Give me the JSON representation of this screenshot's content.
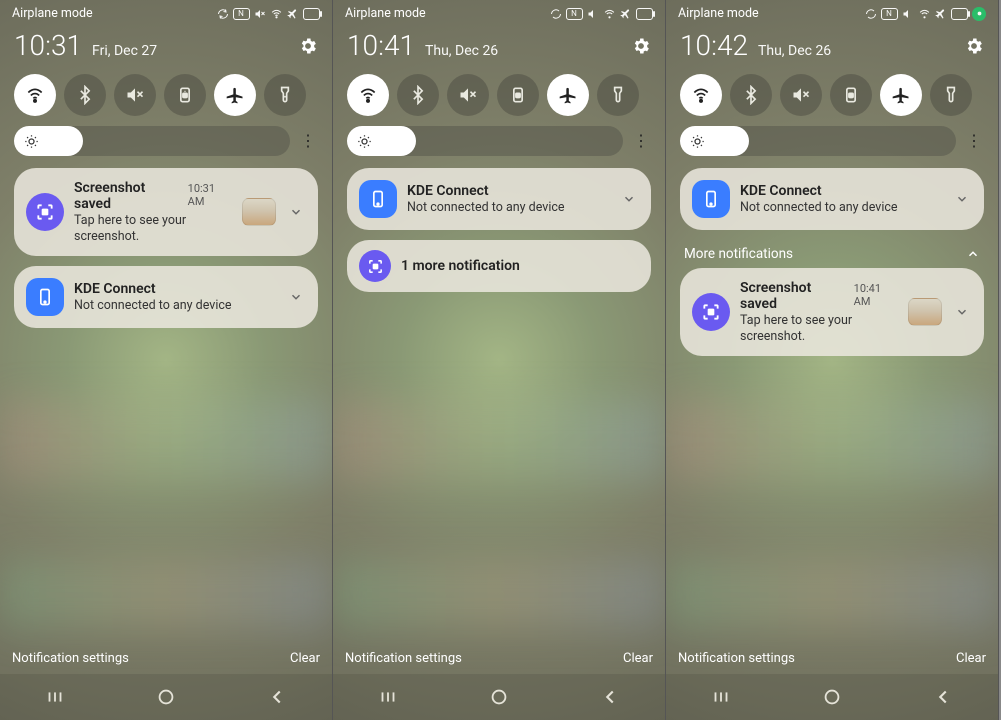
{
  "panels": [
    {
      "status_left": "Airplane mode",
      "clock": "10:31",
      "date": "Fri, Dec 27",
      "toggles": [
        "wifi",
        "bluetooth",
        "mute",
        "rotation-lock",
        "airplane",
        "flashlight"
      ],
      "active_toggles": [
        "wifi",
        "airplane"
      ],
      "notifs": [
        {
          "kind": "screenshot",
          "title": "Screenshot saved",
          "time": "10:31 AM",
          "body": "Tap here to see your screenshot.",
          "thumb": true
        },
        {
          "kind": "kde",
          "title": "KDE Connect",
          "body": "Not connected to any device"
        }
      ],
      "section_header": null,
      "more_notif_pill": null,
      "bottom_left": "Notification settings",
      "bottom_right": "Clear"
    },
    {
      "status_left": "Airplane mode",
      "clock": "10:41",
      "date": "Thu, Dec 26",
      "toggles": [
        "wifi",
        "bluetooth",
        "mute",
        "rotation-lock",
        "airplane",
        "flashlight"
      ],
      "active_toggles": [
        "wifi",
        "airplane"
      ],
      "notifs": [
        {
          "kind": "kde",
          "title": "KDE Connect",
          "body": "Not connected to any device"
        }
      ],
      "section_header": null,
      "more_notif_pill": "1 more notification",
      "bottom_left": "Notification settings",
      "bottom_right": "Clear"
    },
    {
      "status_left": "Airplane mode",
      "clock": "10:42",
      "date": "Thu, Dec 26",
      "status_green_dot": true,
      "toggles": [
        "wifi",
        "bluetooth",
        "mute",
        "rotation-lock",
        "airplane",
        "flashlight"
      ],
      "active_toggles": [
        "wifi",
        "airplane"
      ],
      "notifs": [
        {
          "kind": "kde",
          "title": "KDE Connect",
          "body": "Not connected to any device"
        }
      ],
      "section_header": "More notifications",
      "section_notifs": [
        {
          "kind": "screenshot",
          "title": "Screenshot saved",
          "time": "10:41 AM",
          "body": "Tap here to see your screenshot.",
          "thumb": true
        }
      ],
      "more_notif_pill": null,
      "bottom_left": "Notification settings",
      "bottom_right": "Clear"
    }
  ]
}
